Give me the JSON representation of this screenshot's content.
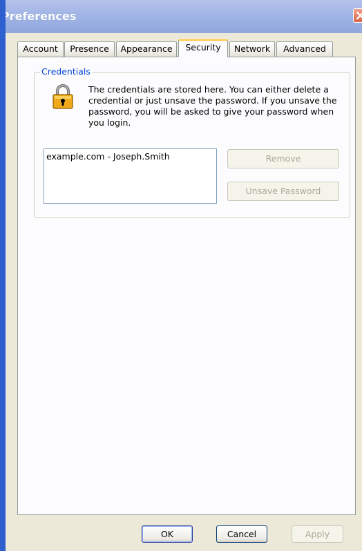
{
  "window": {
    "title": "Preferences"
  },
  "tabs": [
    {
      "label": "Account"
    },
    {
      "label": "Presence"
    },
    {
      "label": "Appearance"
    },
    {
      "label": "Security",
      "active": true
    },
    {
      "label": "Network"
    },
    {
      "label": "Advanced"
    }
  ],
  "credentials": {
    "group_title": "Credentials",
    "description": "The credentials are stored here. You can either delete a credential or just unsave the password. If you unsave the password, you will be asked to give your password when you login.",
    "items": [
      "example.com - Joseph.Smith"
    ],
    "remove_label": "Remove",
    "unsave_label": "Unsave Password"
  },
  "footer": {
    "ok_label": "OK",
    "cancel_label": "Cancel",
    "apply_label": "Apply"
  },
  "colors": {
    "titlebar": "#a3b6e6",
    "window_border": "#2e5fcf",
    "group_title": "#0046d5",
    "active_tab_accent": "#ffc83c"
  },
  "icons": {
    "lock": "padlock-icon",
    "close": "close-icon"
  }
}
